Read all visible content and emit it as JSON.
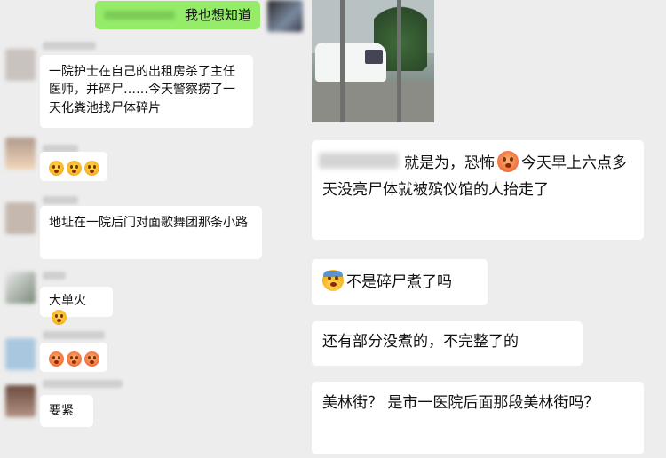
{
  "top_bubble": {
    "text": "我也想知道"
  },
  "left_messages": [
    {
      "text": "一院护士在自己的出租房杀了主任医师，并碎尸……今天警察捞了一天化粪池找尸体碎片"
    },
    {
      "emojis": [
        "emoji-face",
        "emoji-face",
        "emoji-face"
      ]
    },
    {
      "text": "地址在一院后门对面歌舞团那条小路"
    },
    {
      "text": "大单火",
      "emoji": "emoji-face"
    },
    {
      "emojis": [
        "emoji-face",
        "emoji-face",
        "emoji-face"
      ]
    },
    {
      "text": "要紧"
    }
  ],
  "right_messages": [
    {
      "text": "就是为，恐怖",
      "emoji": "red-face-emoji",
      "text2": "今天早上六点多天没亮尸体就被殡仪馆的人抬走了"
    },
    {
      "emoji": "fearful-face-emoji",
      "text": "不是碎尸煮了吗"
    },
    {
      "text": "还有部分没煮的，不完整了的"
    },
    {
      "text": "美林街？ 是市一医院后面那段美林街吗？"
    }
  ],
  "colors": {
    "background": "#ededed",
    "bubble": "#ffffff",
    "self_bubble": "#95ec69"
  }
}
